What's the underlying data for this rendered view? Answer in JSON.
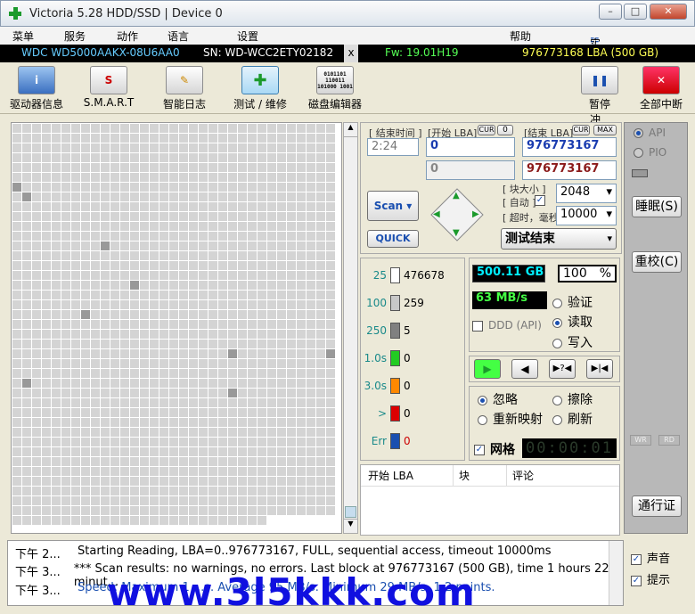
{
  "window": {
    "title": "Victoria 5.28 HDD/SSD | Device 0",
    "minimize": "–",
    "maximize": "□",
    "close": "✕"
  },
  "menu": {
    "items": [
      "菜单",
      "服务",
      "动作",
      "语言",
      "设置",
      "帮助"
    ],
    "realtime_buffer": "实时查看缓冲区"
  },
  "drive": {
    "model": "WDC WD5000AAKX-08U6AA0",
    "serial": "SN: WD-WCC2ETY02182",
    "x": "x",
    "firmware": "Fw: 19.01H19",
    "lba": "976773168 LBA (500 GB)"
  },
  "toolbar": {
    "drive_info": "驱动器信息",
    "smart": "S.M.A.R.T",
    "smart_log": "智能日志",
    "test": "测试 / 维修",
    "disk_editor": "磁盘编辑器",
    "pause": "暂停",
    "stop_all": "全部中断",
    "smart_icon_text": "S",
    "editor_icon_text": "0101101 110011 101000 1001"
  },
  "scan": {
    "end_time_label": "[ 结束时间 ]",
    "start_lba_label": "[开始 LBA]",
    "cur": "CUR",
    "zero_btn": "0",
    "end_lba_label": "[结束 LBA]",
    "cur2": "CUR",
    "max": "MAX",
    "time_value": "2:24",
    "start_lba": "0",
    "end_lba": "976773167",
    "start_lba2": "0",
    "end_lba2": "976773167",
    "block_size_label": "[ 块大小 ]",
    "auto_label": "[ 自动 ]",
    "timeout_label": "[ 超时，毫秒 ]",
    "block_size": "2048",
    "timeout": "10000",
    "scan_button": "Scan",
    "quick_button": "QUICK",
    "status": "测试结束"
  },
  "legend": [
    {
      "label": "25",
      "count": "476678",
      "color": "#ffffff"
    },
    {
      "label": "100",
      "count": "259",
      "color": "#c8c8c8"
    },
    {
      "label": "250",
      "count": "5",
      "color": "#808080"
    },
    {
      "label": "1.0s",
      "count": "0",
      "color": "#22cc22"
    },
    {
      "label": "3.0s",
      "count": "0",
      "color": "#ff8800"
    },
    {
      "label": ">",
      "count": "0",
      "color": "#dd0000"
    },
    {
      "label": "Err",
      "count": "0",
      "color": "#1a4fb0"
    }
  ],
  "stats": {
    "size": "500.11 GB",
    "percent": "100",
    "percent_sign": "%",
    "speed": "63 MB/s",
    "ddd": "DDD (API)"
  },
  "modes": {
    "verify": "验证",
    "read": "读取",
    "write": "写入"
  },
  "actions": {
    "ignore": "忽略",
    "erase": "擦除",
    "remap": "重新映射",
    "refresh": "刷新",
    "grid": "网格",
    "timer": "00:00:01"
  },
  "table": {
    "headers": [
      "开始 LBA",
      "块",
      "评论"
    ]
  },
  "right": {
    "api": "API",
    "pio": "PIO",
    "sleep": "睡眠(S)",
    "reset": "重校(C)",
    "wr": "WR",
    "rd": "RD",
    "passport": "通行证"
  },
  "log": [
    {
      "time": "下午 2...",
      "text": "Starting Reading, LBA=0..976773167, FULL, sequential access, timeout 10000ms"
    },
    {
      "time": "下午 3...",
      "text": "*** Scan results: no warnings, no errors. Last block at 976773167 (500 GB), time 1 hours 22 minut..."
    },
    {
      "time": "下午 3...",
      "text": "Speed: Maximum 1 ...s. Average 95 MB/s. Minimum 29 MB/s. 1 2 points."
    }
  ],
  "options": {
    "sound": "声音",
    "hints": "提示"
  },
  "watermark": "www.3l5kkk.com"
}
